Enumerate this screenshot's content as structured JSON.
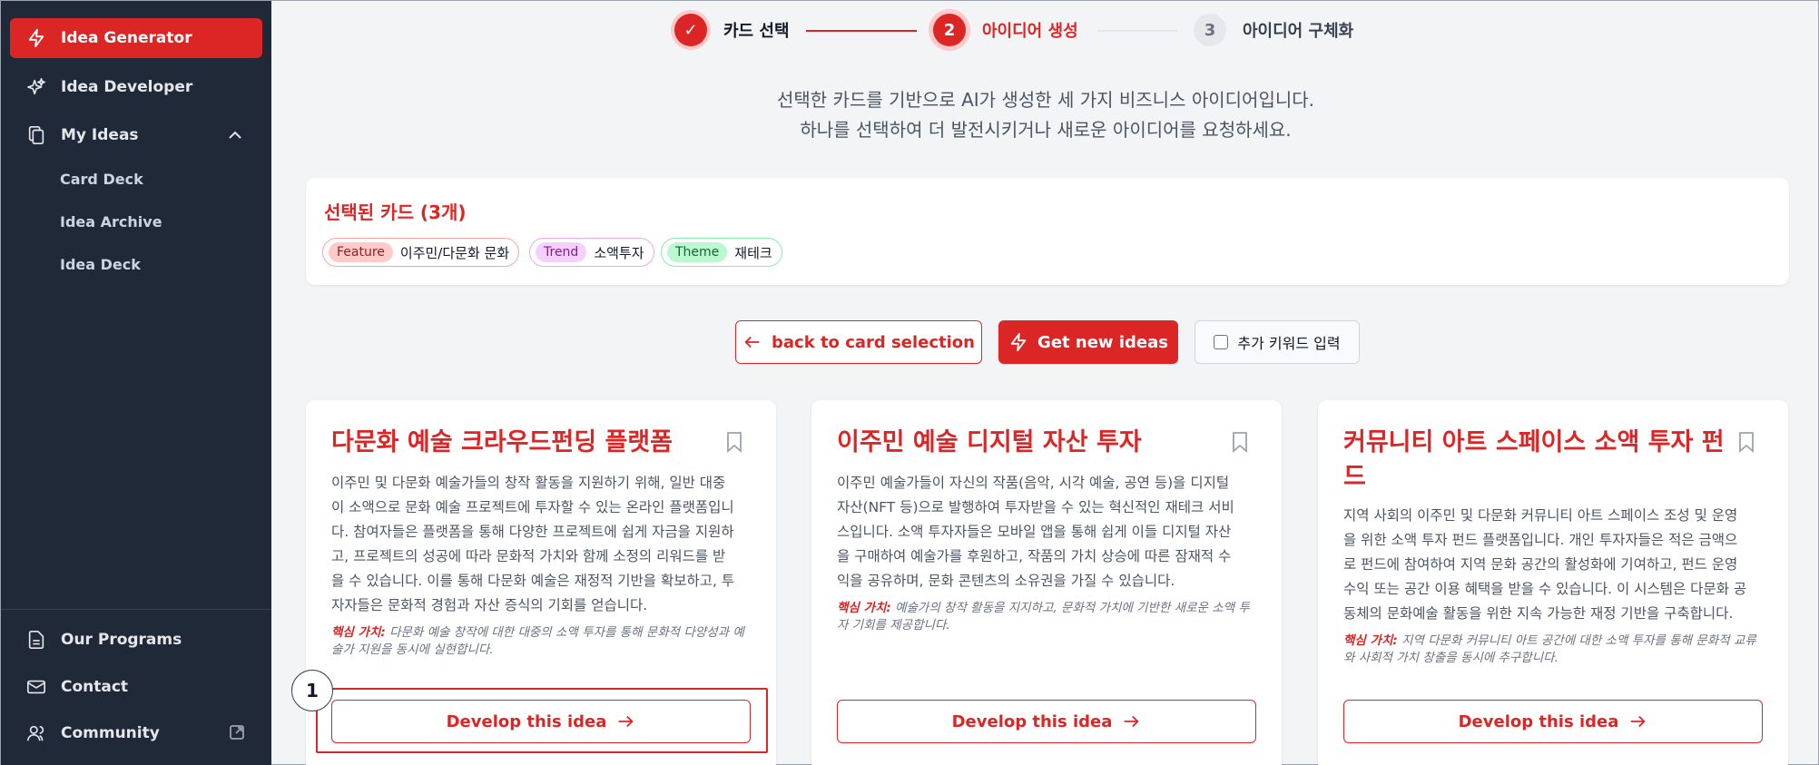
{
  "sidebar": {
    "items": [
      {
        "label": "Idea Generator",
        "icon": "lightning-icon"
      },
      {
        "label": "Idea Developer",
        "icon": "sparkle-icon"
      },
      {
        "label": "My Ideas",
        "icon": "documents-icon"
      }
    ],
    "sub_items": [
      "Card Deck",
      "Idea Archive",
      "Idea Deck"
    ],
    "bottom_items": [
      {
        "label": "Our Programs",
        "icon": "document-icon"
      },
      {
        "label": "Contact",
        "icon": "mail-icon"
      },
      {
        "label": "Community",
        "icon": "users-icon"
      }
    ]
  },
  "stepper": {
    "steps": [
      {
        "number": "✓",
        "label": "카드 선택"
      },
      {
        "number": "2",
        "label": "아이디어 생성"
      },
      {
        "number": "3",
        "label": "아이디어 구체화"
      }
    ]
  },
  "intro": {
    "line1": "선택한 카드를 기반으로 AI가 생성한 세 가지 비즈니스 아이디어입니다.",
    "line2": "하나를 선택하여 더 발전시키거나 새로운 아이디어를 요청하세요."
  },
  "selected": {
    "title": "선택된 카드 (3개)",
    "chips": [
      {
        "tag": "Feature",
        "value": "이주민/다문화 문화"
      },
      {
        "tag": "Trend",
        "value": "소액투자"
      },
      {
        "tag": "Theme",
        "value": "재테크"
      }
    ]
  },
  "actions": {
    "back_label": "back to card selection",
    "new_label": "Get new ideas",
    "keyword_label": "추가 키워드 입력"
  },
  "value_label": "핵심 가치:",
  "develop_label": "Develop this idea",
  "ideas": [
    {
      "title": "다문화 예술 크라우드펀딩 플랫폼",
      "desc_lines": [
        "이주민 및 다문화 예술가들의 창작 활동을 지원하기 위해, 일반 대중",
        "이 소액으로 문화 예술 프로젝트에 투자할 수 있는 온라인 플랫폼입니",
        "다. 참여자들은 플랫폼을 통해 다양한 프로젝트에 쉽게 자금을 지원하",
        "고, 프로젝트의 성공에 따라 문화적 가치와 함께 소정의 리워드를 받",
        "을 수 있습니다. 이를 통해 다문화 예술은 재정적 기반을 확보하고, 투",
        "자자들은 문화적 경험과 자산 증식의 기회를 얻습니다."
      ],
      "value_lines": [
        "다문화 예술 창작에 대한 대중의 소액 투자를 통해 문화적 다양성과 예",
        "술가 지원을 동시에 실현합니다."
      ]
    },
    {
      "title": "이주민 예술 디지털 자산 투자",
      "desc_lines": [
        "이주민 예술가들이 자신의 작품(음악, 시각 예술, 공연 등)을 디지털",
        "자산(NFT 등)으로 발행하여 투자받을 수 있는 혁신적인 재테크 서비",
        "스입니다. 소액 투자자들은 모바일 앱을 통해 쉽게 이들 디지털 자산",
        "을 구매하여 예술가를 후원하고, 작품의 가치 상승에 따른 잠재적 수",
        "익을 공유하며, 문화 콘텐츠의 소유권을 가질 수 있습니다."
      ],
      "value_lines": [
        "예술가의 창작 활동을 지지하고, 문화적 가치에 기반한 새로운 소액 투",
        "자 기회를 제공합니다."
      ]
    },
    {
      "title": "커뮤니티 아트 스페이스 소액 투자 펀드",
      "desc_lines": [
        "지역 사회의 이주민 및 다문화 커뮤니티 아트 스페이스 조성 및 운영",
        "을 위한 소액 투자 펀드 플랫폼입니다. 개인 투자자들은 적은 금액으",
        "로 펀드에 참여하여 지역 문화 공간의 활성화에 기여하고, 펀드 운영",
        "수익 또는 공간 이용 혜택을 받을 수 있습니다. 이 시스템은 다문화 공",
        "동체의 문화예술 활동을 위한 지속 가능한 재정 기반을 구축합니다."
      ],
      "value_lines": [
        "지역 다문화 커뮤니티 아트 공간에 대한 소액 투자를 통해 문화적 교류",
        "와 사회적 가치 창출을 동시에 추구합니다."
      ]
    }
  ],
  "annotation": {
    "marker": "1"
  },
  "colors": {
    "accent": "#dc2626",
    "sidebar": "#1f2937"
  }
}
